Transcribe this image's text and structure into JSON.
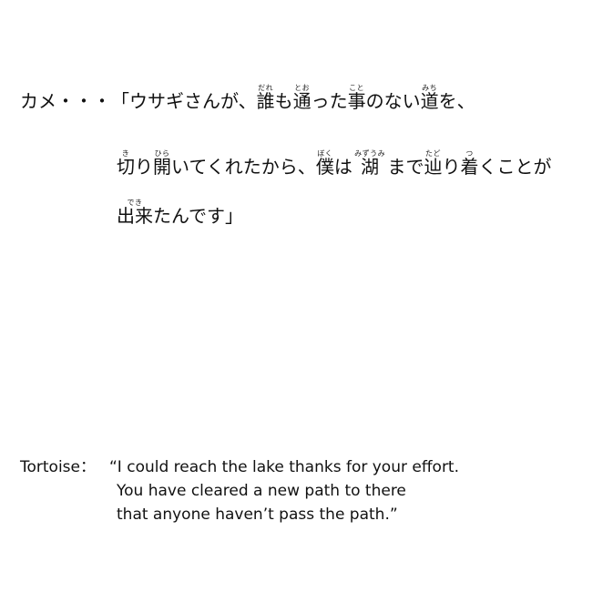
{
  "japanese": {
    "speaker": "カメ・・・",
    "line1": [
      {
        "text": "「ウサギさんが、"
      },
      {
        "text": "誰",
        "ruby": "だれ"
      },
      {
        "text": "も"
      },
      {
        "text": "通",
        "ruby": "とお"
      },
      {
        "text": "った"
      },
      {
        "text": "事",
        "ruby": "こと"
      },
      {
        "text": "のない"
      },
      {
        "text": "道",
        "ruby": "みち"
      },
      {
        "text": "を、"
      }
    ],
    "line2": [
      {
        "text": "切",
        "ruby": "き"
      },
      {
        "text": "り"
      },
      {
        "text": "開",
        "ruby": "ひら"
      },
      {
        "text": "いてくれたから、"
      },
      {
        "text": "僕",
        "ruby": "ぼく"
      },
      {
        "text": "は "
      },
      {
        "text": "湖",
        "ruby": "みずうみ"
      },
      {
        "text": " まで"
      },
      {
        "text": "辿",
        "ruby": "たど"
      },
      {
        "text": "り"
      },
      {
        "text": "着",
        "ruby": "つ"
      },
      {
        "text": "くことが"
      }
    ],
    "line3": [
      {
        "text": "出来",
        "ruby": "でき"
      },
      {
        "text": "たんです」"
      }
    ]
  },
  "english": {
    "speaker": "Tortoise：",
    "lines": [
      "“I could reach the lake thanks for your effort.",
      "You have cleared a new path to there",
      "that anyone haven’t pass the path.”"
    ]
  }
}
